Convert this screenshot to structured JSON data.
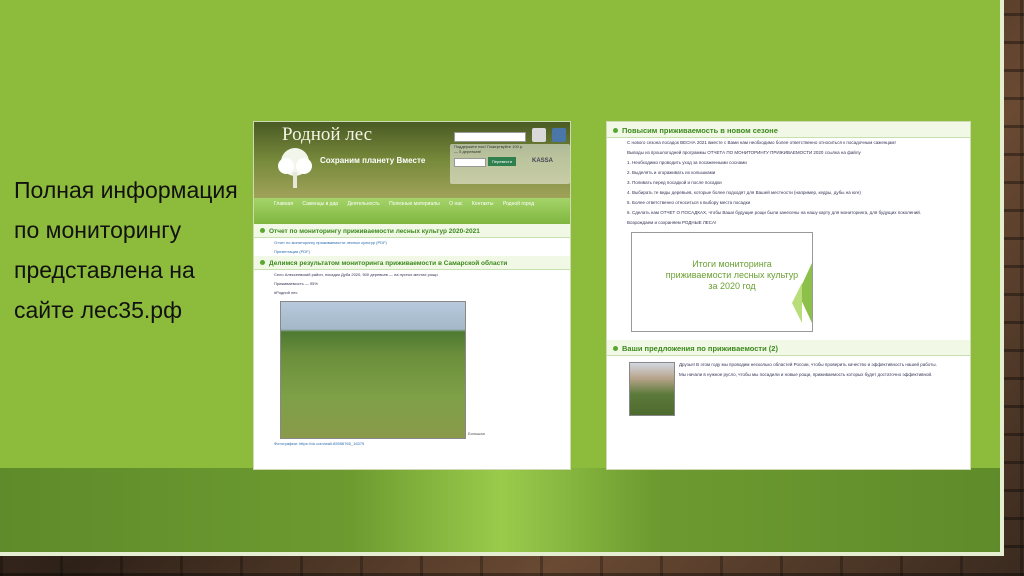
{
  "slide": {
    "text": "Полная информация по мониторингу представлена на сайте лес35.рф"
  },
  "left_screenshot": {
    "logo": "Родной лес",
    "slogan": "Сохраним планету Вместе",
    "donate_text": "Поддержите нас! Пожертвуйте 100 р. — 5 деревьев!",
    "donate_amount": "100",
    "donate_button": "Перевести",
    "kassa": "KASSA",
    "nav": [
      "Главная",
      "Саженцы в дар",
      "Деятельность",
      "Полезные материалы",
      "О нас",
      "Контакты",
      "Родной город"
    ],
    "section1_title": "Отчет по мониторингу приживаемости лесных культур 2020-2021",
    "section1_link1": "Отчет по мониторингу приживаемости лесных культур (PDF)",
    "section1_link2": "Презентация (PDF)",
    "section2_title": "Делимся результатом мониторинга приживаемости в Самарской области",
    "section2_line1": "Село Алексеевский район, посадки Дуба 2020, 500 деревьев — на пустых местах рощи",
    "section2_line2": "Приживаемость — 95%",
    "section2_line3": "#Родной лес",
    "photo_caption": "Большая",
    "footer_text": "Фотографии: https://vk.com/wall-65956765_16379"
  },
  "right_screenshot": {
    "section1_title": "Повысим приживаемость в новом сезоне",
    "intro": "С нового сезона посадок ВЕСНА 2021 вместе с Вами нам необходимо более ответственно относиться к посадочным саженцам!",
    "summary": "Выводы из прошлогодней программы ОТЧЕТА ПО МОНИТОРИНГУ ПРИЖИВАЕМОСТИ 2020 ссылка на файлу",
    "items": [
      "1. Необходимо проводить уход за посаженными соснами",
      "2. Выделять и огораживать их колышками",
      "3. Поливать перед посадкой и после посадки",
      "4. Выбирать те виды деревьев, которые более подходят для Вашей местности (например, кедры, дубы на юге)",
      "5. Более ответственно относиться к выбору места посадки",
      "6. Сделать нам ОТЧЕТ О ПОСАДКАХ, чтобы Ваши будущие рощи были занесены на нашу карту для мониторинга, для будущих поколений."
    ],
    "signature": "Возрождаем и сохраняем РОДНЫЕ ЛЕСА!",
    "thumb_text": "Итоги мониторинга приживаемости лесных культур за 2020 год",
    "section2_title": "Ваши предложения по приживаемости (2)",
    "proposal1": "Друзья! В этом году мы проводим несколько областей России, чтобы проверить качество и эффективность нашей работы.",
    "proposal2": "Мы начали в нужное русло, чтобы мы посадили и новые рощи, приживаемость которых будет достаточно эффективной."
  }
}
